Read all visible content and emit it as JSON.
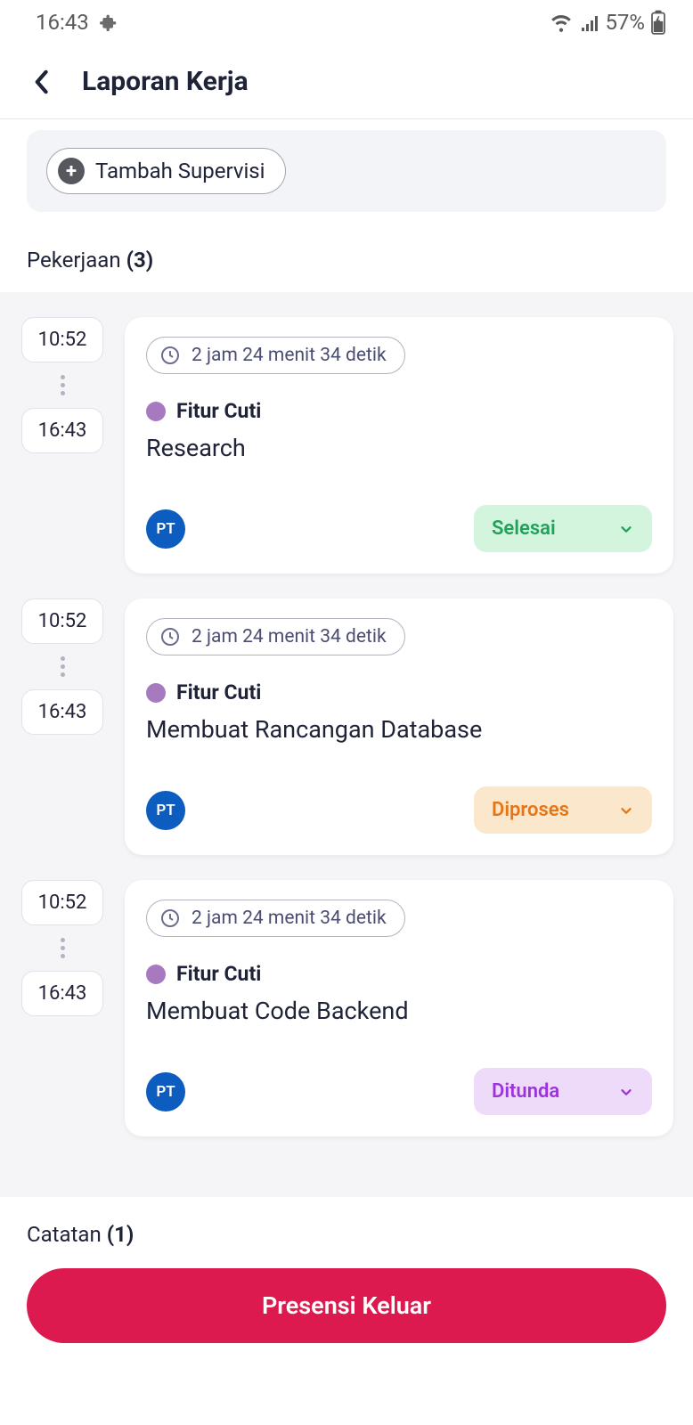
{
  "status": {
    "time": "16:43",
    "battery": "57%"
  },
  "header": {
    "title": "Laporan Kerja"
  },
  "supervisi": {
    "add_label": "Tambah Supervisi"
  },
  "pekerjaan": {
    "label": "Pekerjaan",
    "count": "(3)"
  },
  "tasks": [
    {
      "start": "10:52",
      "end": "16:43",
      "duration": "2 jam 24 menit 34 detik",
      "feature": "Fitur Cuti",
      "title": "Research",
      "avatar": "PT",
      "status": "Selesai",
      "status_class": "status-green"
    },
    {
      "start": "10:52",
      "end": "16:43",
      "duration": "2 jam 24 menit 34 detik",
      "feature": "Fitur Cuti",
      "title": "Membuat Rancangan Database",
      "avatar": "PT",
      "status": "Diproses",
      "status_class": "status-orange"
    },
    {
      "start": "10:52",
      "end": "16:43",
      "duration": "2 jam 24 menit 34 detik",
      "feature": "Fitur Cuti",
      "title": "Membuat Code Backend",
      "avatar": "PT",
      "status": "Ditunda",
      "status_class": "status-purple"
    }
  ],
  "catatan": {
    "label": "Catatan",
    "count": "(1)"
  },
  "checkout": {
    "label": "Presensi Keluar"
  }
}
